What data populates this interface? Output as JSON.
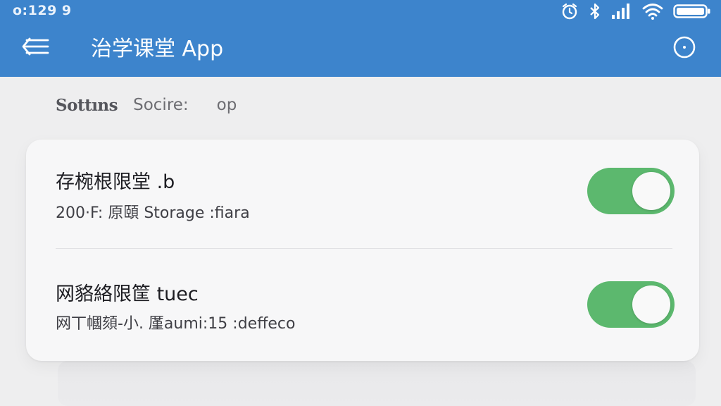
{
  "status_bar": {
    "time": "o:129 9",
    "icons": [
      "alarm-icon",
      "bluetooth-icon",
      "signal-icon",
      "wifi-icon",
      "battery-icon"
    ]
  },
  "app_bar": {
    "title": "治学课堂 App",
    "back_icon": "back-menu-icon",
    "action_icon": "circle-icon"
  },
  "breadcrumb": [
    "Sottıns",
    "Socire:",
    "op"
  ],
  "settings": [
    {
      "title": "存椀根限堂 .b",
      "description": "200·F: 原頤  Storage :fiara",
      "toggle_on": true
    },
    {
      "title": "网貉絡限筐  tuec",
      "description": "网丅幗頦-小. 厪aumi:15 :deffeco",
      "toggle_on": true
    }
  ],
  "colors": {
    "app_bar": "#3d84cc",
    "toggle_on": "#5cb86e",
    "background": "#eeeeef",
    "card": "#f7f7f8"
  }
}
